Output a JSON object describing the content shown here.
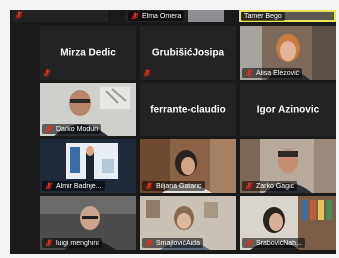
{
  "colors": {
    "muted_icon": "#e0301e",
    "active_border": "#e9e35a",
    "tile_bg": "#232323",
    "name_text": "#ffffff"
  },
  "icons": {
    "muted": "microphone-muted-icon"
  },
  "participants": [
    {
      "name": "Elma Omera",
      "row": 0
    },
    {
      "name": "Tamer Bego",
      "row": 0,
      "active": true
    },
    {
      "name": "Mirza Dedic",
      "row": 1
    },
    {
      "name": "GrubišićJosipa",
      "row": 1
    },
    {
      "name": "Alisa Elezović",
      "row": 1
    },
    {
      "name": "Darko Modun",
      "row": 2
    },
    {
      "name": "ferrante-claudio",
      "row": 2
    },
    {
      "name": "Igor Azinovic",
      "row": 2
    },
    {
      "name": "Almir Badnje...",
      "row": 3
    },
    {
      "name": "Biljana Gataric",
      "row": 3
    },
    {
      "name": "Žarko Gagić",
      "row": 3
    },
    {
      "name": "luigi menghini",
      "row": 4
    },
    {
      "name": "SmajlovićAida",
      "row": 4
    },
    {
      "name": "ŠrabovićNah...",
      "row": 4
    }
  ]
}
